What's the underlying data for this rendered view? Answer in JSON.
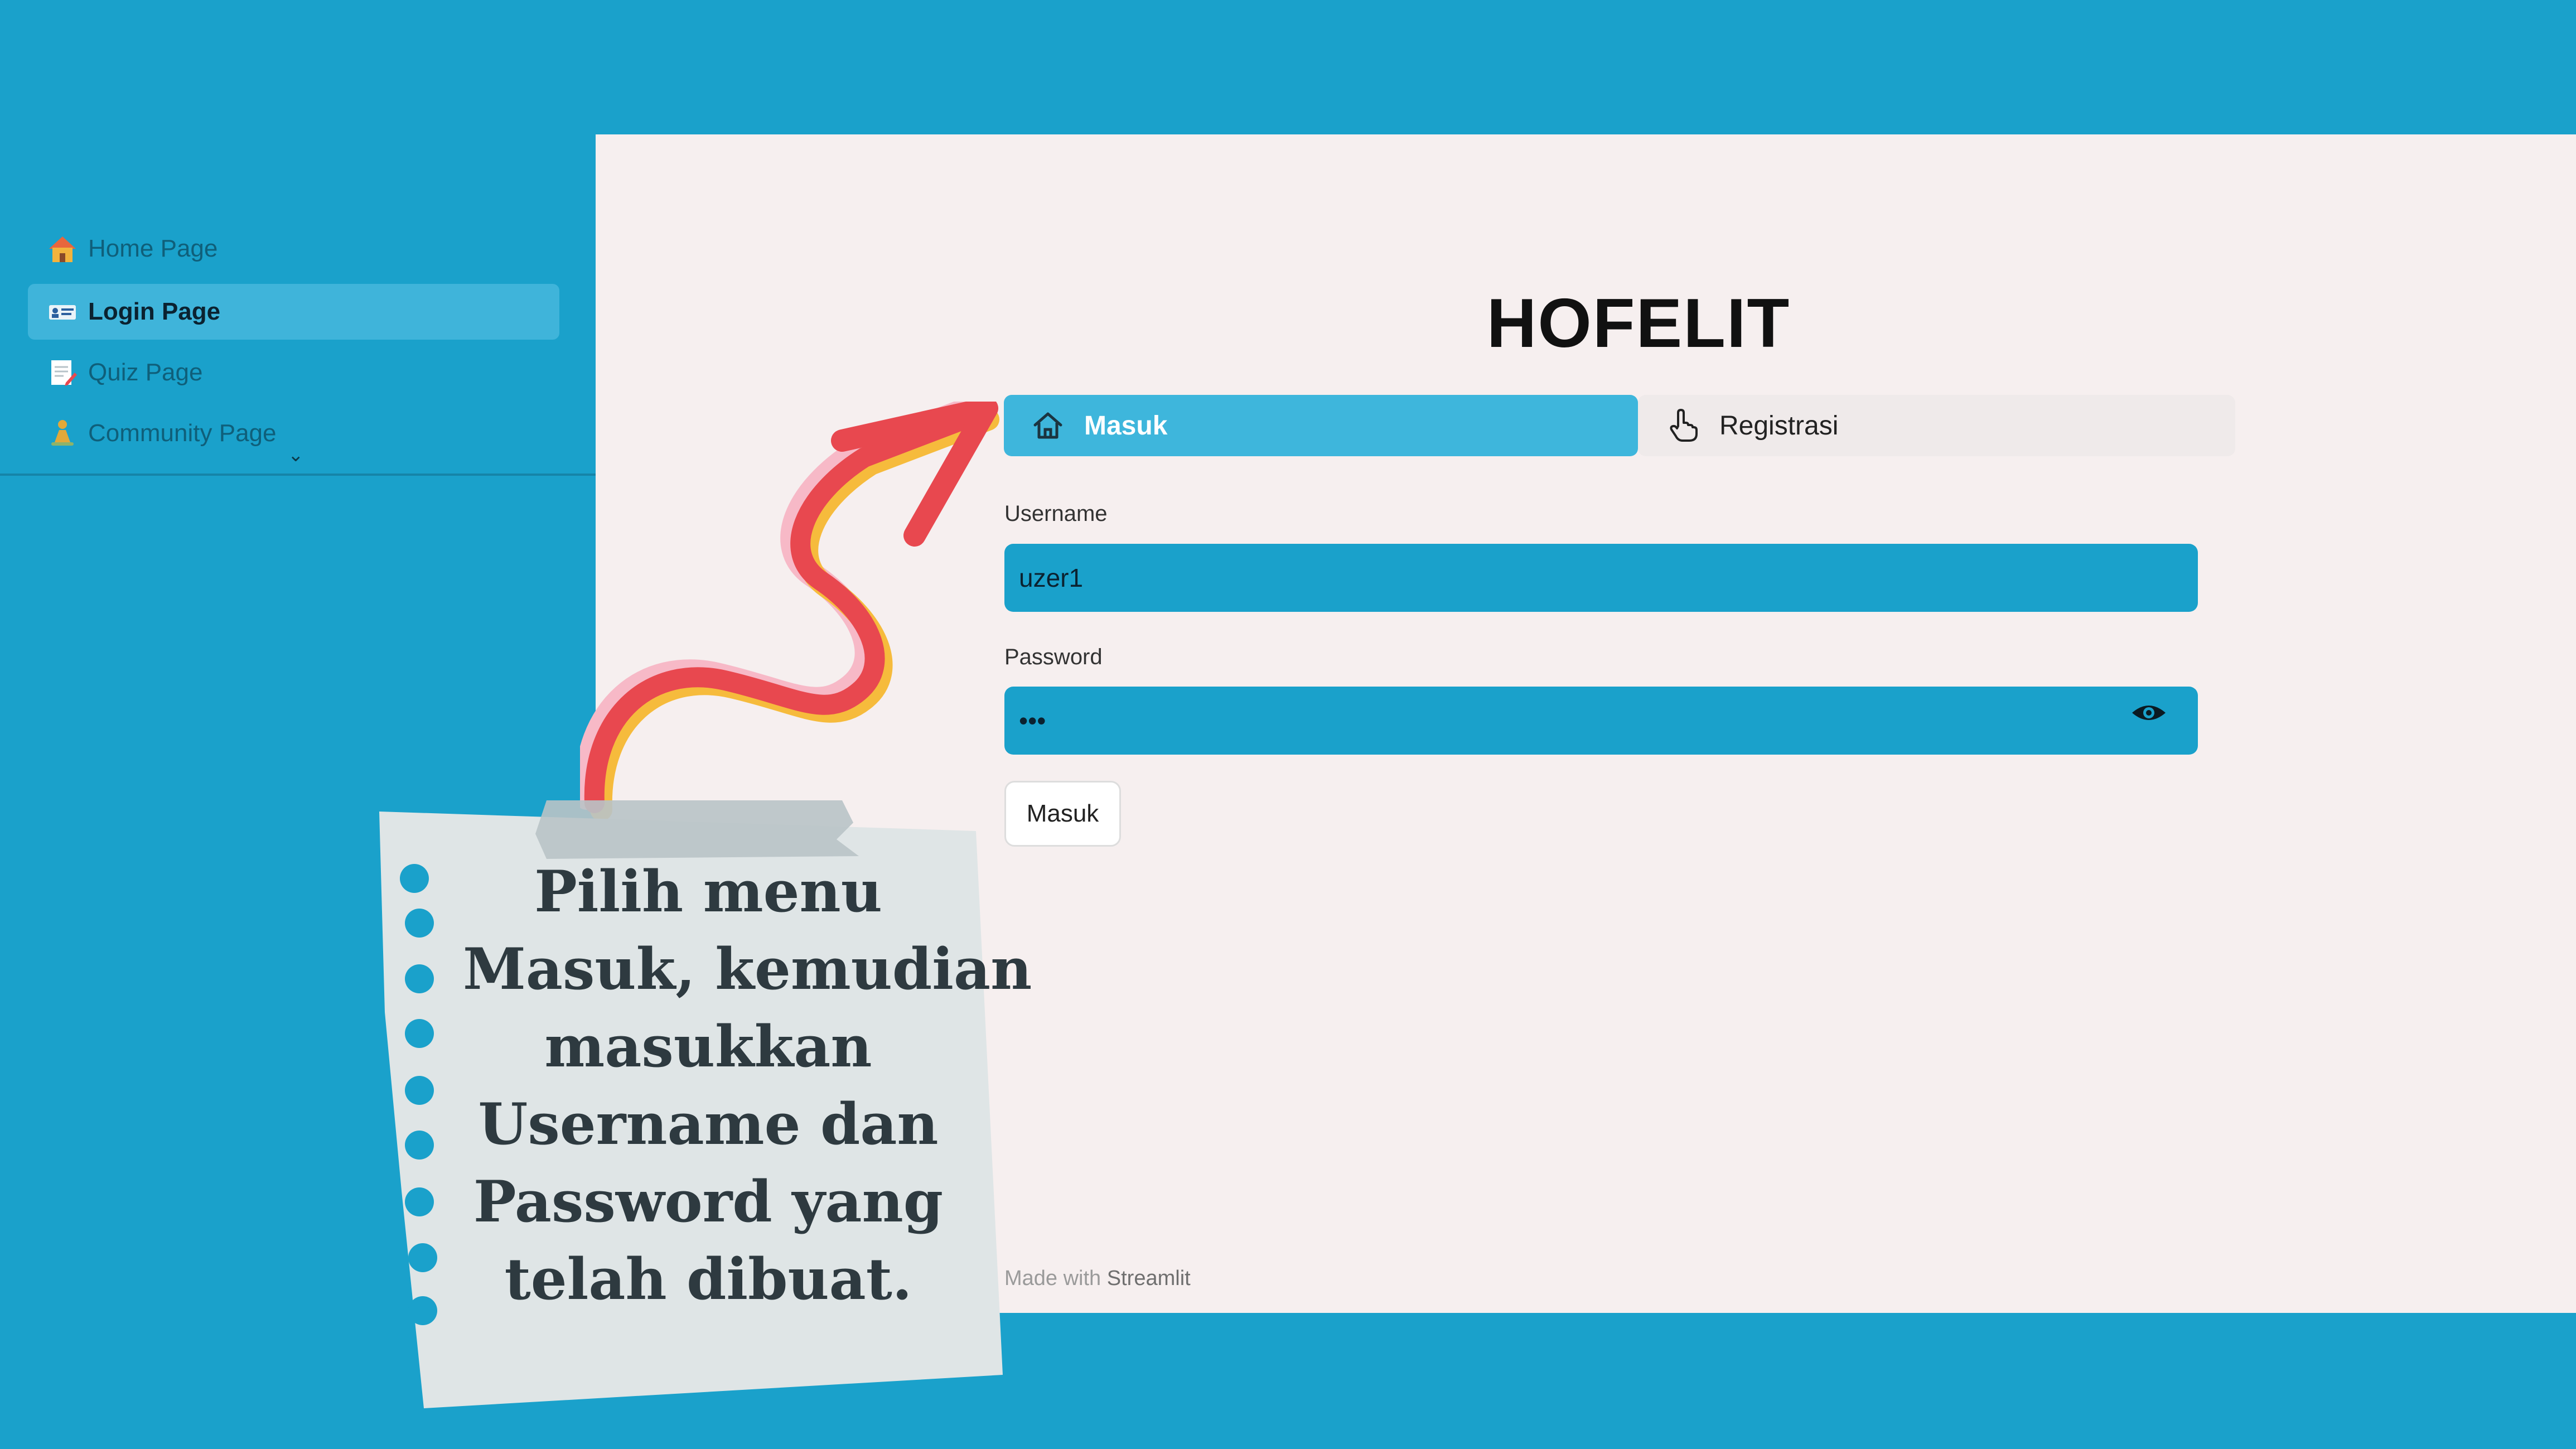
{
  "app": {
    "title": "HOFELIT"
  },
  "sidebar": {
    "items": [
      {
        "label": "Home Page",
        "icon": "house-icon",
        "active": false
      },
      {
        "label": "Login Page",
        "icon": "id-card-icon",
        "active": true
      },
      {
        "label": "Quiz Page",
        "icon": "memo-icon",
        "active": false
      },
      {
        "label": "Community Page",
        "icon": "person-icon",
        "active": false
      }
    ]
  },
  "tabs": [
    {
      "label": "Masuk",
      "icon": "home-outline-icon",
      "selected": true
    },
    {
      "label": "Registrasi",
      "icon": "pointing-hand-icon",
      "selected": false
    }
  ],
  "form": {
    "username_label": "Username",
    "username_value": "uzer1",
    "password_label": "Password",
    "password_value": "•••",
    "submit_label": "Masuk"
  },
  "footer": {
    "prefix": "Made with",
    "brand": "Streamlit"
  },
  "annotation": {
    "lines": [
      "Pilih menu",
      "Masuk, kemudian",
      "masukkan",
      "Username dan",
      "Password yang",
      "telah dibuat."
    ]
  },
  "colors": {
    "background": "#1aa1cb",
    "panel": "#f6efef",
    "active_tab": "#3eb6dc",
    "arrow": "#e8484f",
    "note": "#dfe5e6"
  }
}
